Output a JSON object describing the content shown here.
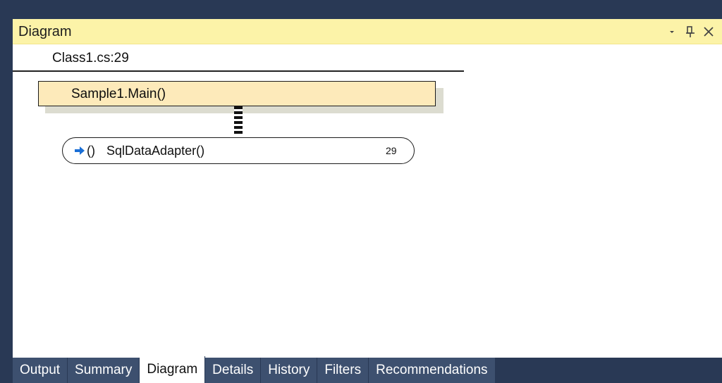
{
  "panel": {
    "title": "Diagram",
    "controls": {
      "dropdown_icon": "dropdown-arrow-icon",
      "pin_icon": "pin-icon",
      "close_icon": "close-icon"
    }
  },
  "breadcrumb": {
    "location": "Class1.cs:29"
  },
  "diagram": {
    "method_node": {
      "label": "Sample1.Main()"
    },
    "call_node": {
      "icon": "call-arrow-icon",
      "parens": "()",
      "label": "SqlDataAdapter()",
      "line": "29"
    }
  },
  "tabs": [
    {
      "label": "Output",
      "active": false
    },
    {
      "label": "Summary",
      "active": false
    },
    {
      "label": "Diagram",
      "active": true
    },
    {
      "label": "Details",
      "active": false
    },
    {
      "label": "History",
      "active": false
    },
    {
      "label": "Filters",
      "active": false
    },
    {
      "label": "Recommendations",
      "active": false
    }
  ],
  "colors": {
    "title_bar": "#fcf3a8",
    "method_node_fill": "#fdeaba",
    "tab_bar_background": "#293955",
    "tab_background": "#3d506f",
    "arrow_icon": "#1a6fd6"
  }
}
